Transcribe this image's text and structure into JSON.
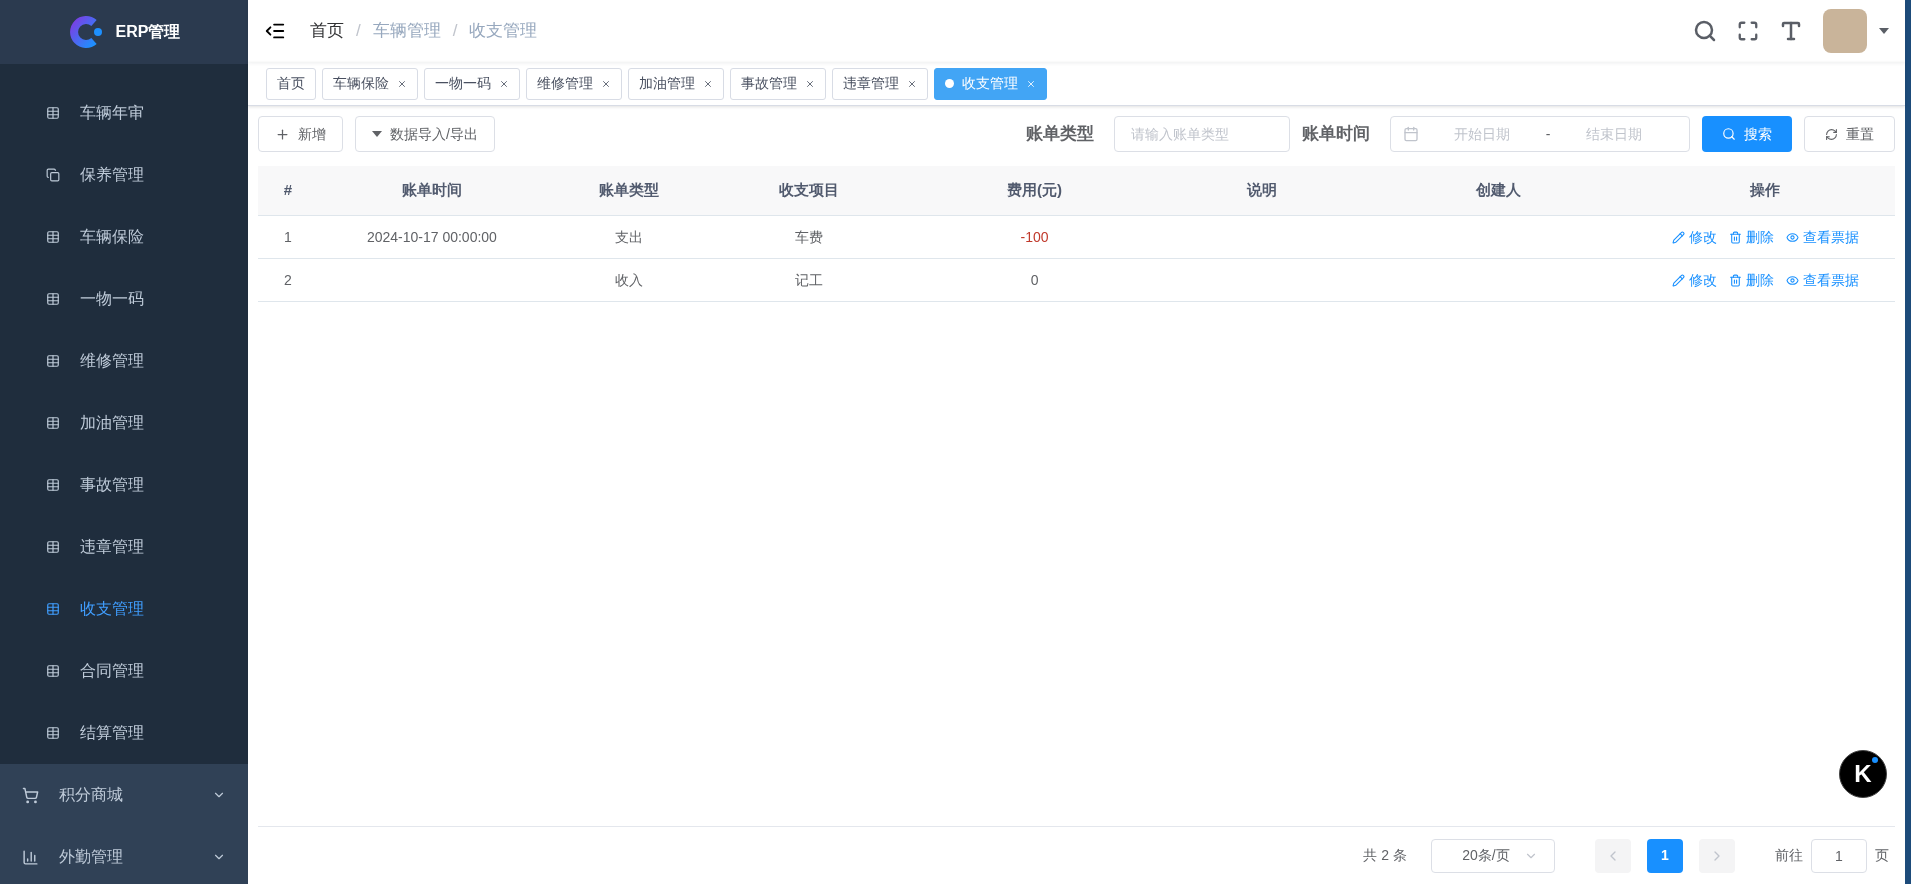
{
  "sidebar": {
    "title": "ERP管理",
    "items": [
      {
        "label": "车辆年审",
        "kind": "table",
        "selected": false
      },
      {
        "label": "保养管理",
        "kind": "copy",
        "selected": false
      },
      {
        "label": "车辆保险",
        "kind": "table",
        "selected": false
      },
      {
        "label": "一物一码",
        "kind": "table",
        "selected": false
      },
      {
        "label": "维修管理",
        "kind": "table",
        "selected": false
      },
      {
        "label": "加油管理",
        "kind": "table",
        "selected": false
      },
      {
        "label": "事故管理",
        "kind": "table",
        "selected": false
      },
      {
        "label": "违章管理",
        "kind": "table",
        "selected": false
      },
      {
        "label": "收支管理",
        "kind": "table",
        "selected": true
      },
      {
        "label": "合同管理",
        "kind": "table",
        "selected": false
      },
      {
        "label": "结算管理",
        "kind": "table",
        "selected": false
      }
    ],
    "groups": [
      {
        "label": "积分商城",
        "kind": "cart",
        "expanded": false
      },
      {
        "label": "外勤管理",
        "kind": "chart",
        "expanded": false
      }
    ]
  },
  "breadcrumb": [
    "首页",
    "/",
    "车辆管理",
    "/",
    "收支管理"
  ],
  "tags": [
    {
      "label": "首页",
      "closable": false,
      "selected": false
    },
    {
      "label": "车辆保险",
      "closable": true,
      "selected": false
    },
    {
      "label": "一物一码",
      "closable": true,
      "selected": false
    },
    {
      "label": "维修管理",
      "closable": true,
      "selected": false
    },
    {
      "label": "加油管理",
      "closable": true,
      "selected": false
    },
    {
      "label": "事故管理",
      "closable": true,
      "selected": false
    },
    {
      "label": "违章管理",
      "closable": true,
      "selected": false
    },
    {
      "label": "收支管理",
      "closable": true,
      "selected": true
    }
  ],
  "toolbar": {
    "add": "新增",
    "import_export": "数据导入/导出",
    "type_label": "账单类型",
    "type_placeholder": "请输入账单类型",
    "time_label": "账单时间",
    "start_placeholder": "开始日期",
    "separator": "-",
    "end_placeholder": "结束日期",
    "search": "搜索",
    "reset": "重置"
  },
  "table": {
    "columns": [
      "#",
      "账单时间",
      "账单类型",
      "收支项目",
      "费用(元)",
      "说明",
      "创建人",
      "操作"
    ],
    "rows": [
      {
        "cells": [
          "1",
          "2024-10-17 00:00:00",
          "支出",
          "车费",
          "-100",
          "",
          ""
        ],
        "negative": true,
        "actions": [
          "修改",
          "删除",
          "查看票据"
        ]
      },
      {
        "cells": [
          "2",
          "",
          "收入",
          "记工",
          "0",
          "",
          ""
        ],
        "negative": false,
        "actions": [
          "修改",
          "删除",
          "查看票据"
        ]
      }
    ]
  },
  "pagination": {
    "total": "共 2 条",
    "page_size": "20条/页",
    "pages": [
      {
        "label": "1",
        "selected": true
      }
    ],
    "goto": "前往",
    "goto_value": "1",
    "page_unit": "页"
  },
  "floating_badge": "K"
}
